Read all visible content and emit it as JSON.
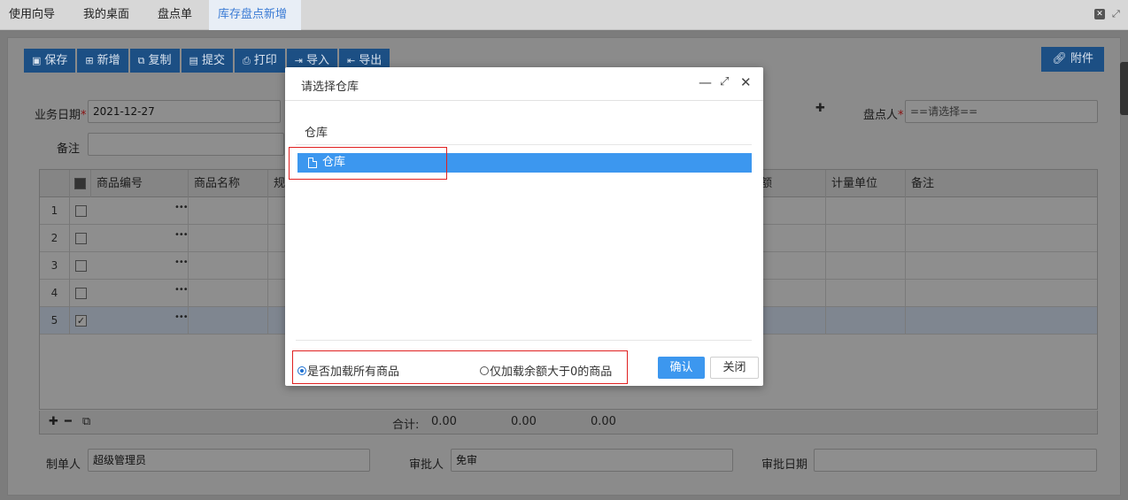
{
  "tabs": [
    {
      "label": "使用向导",
      "active": false
    },
    {
      "label": "我的桌面",
      "active": false
    },
    {
      "label": "盘点单",
      "active": false
    },
    {
      "label": "库存盘点新增",
      "active": true
    }
  ],
  "toolbar": {
    "save": "保存",
    "new": "新增",
    "copy": "复制",
    "submit": "提交",
    "print": "打印",
    "import": "导入",
    "export": "导出",
    "attach": "附件"
  },
  "form": {
    "biz_date_label": "业务日期",
    "biz_date_value": "2021-12-27",
    "remark_label": "备注",
    "counter_label": "盘点人",
    "counter_placeholder": "==请选择=="
  },
  "grid": {
    "columns": [
      "商品编号",
      "商品名称",
      "规",
      "额",
      "计量单位",
      "备注"
    ],
    "rows": [
      {
        "num": "1",
        "checked": false
      },
      {
        "num": "2",
        "checked": false
      },
      {
        "num": "3",
        "checked": false
      },
      {
        "num": "4",
        "checked": false
      },
      {
        "num": "5",
        "checked": true
      }
    ],
    "total_label": "合计:",
    "totals": [
      "0.00",
      "0.00",
      "0.00"
    ]
  },
  "footer": {
    "creator_label": "制单人",
    "creator_value": "超级管理员",
    "approver_label": "审批人",
    "approver_value": "免审",
    "approve_date_label": "审批日期"
  },
  "modal": {
    "title": "请选择仓库",
    "section": "仓库",
    "tree_item": "仓库",
    "radio_all": "是否加载所有商品",
    "radio_positive": "仅加载余额大于0的商品",
    "confirm": "确认",
    "close": "关闭"
  },
  "colors": {
    "accent": "#3c97ef",
    "highlight": "#e02020",
    "toolbar": "#1c4f84"
  }
}
